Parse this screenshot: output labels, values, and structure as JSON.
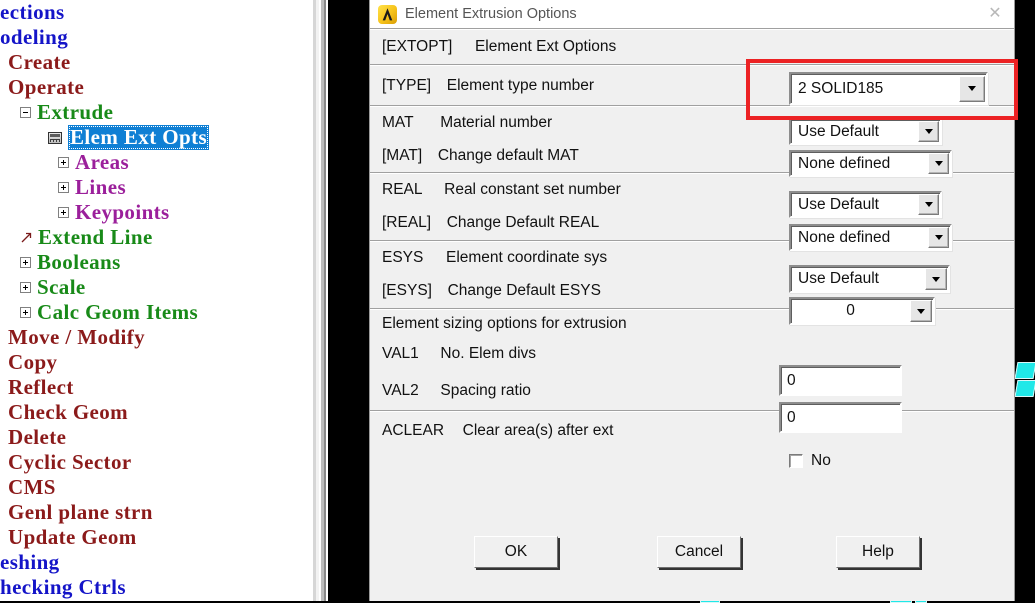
{
  "window": {
    "title": "Element Extrusion Options",
    "logo_icon": "ansys-logo-icon",
    "close_icon": "close-icon",
    "close_glyph": "✕"
  },
  "tree": {
    "items": [
      {
        "label": "ections",
        "color": "#1414c8",
        "indent": 0,
        "icon": "none"
      },
      {
        "label": "odeling",
        "color": "#1414c8",
        "indent": 0,
        "icon": "none"
      },
      {
        "label": "Create",
        "color": "#8b1a1a",
        "indent": 8,
        "icon": "none"
      },
      {
        "label": "Operate",
        "color": "#8b1a1a",
        "indent": 8,
        "icon": "none"
      },
      {
        "label": "Extrude",
        "color": "#188a18",
        "indent": 20,
        "icon": "minus"
      },
      {
        "label": "Elem Ext Opts",
        "color": "#1414c8",
        "indent": 48,
        "icon": "sheet",
        "selected": true
      },
      {
        "label": "Areas",
        "color": "#9b1f9b",
        "indent": 58,
        "icon": "plus"
      },
      {
        "label": "Lines",
        "color": "#9b1f9b",
        "indent": 58,
        "icon": "plus"
      },
      {
        "label": "Keypoints",
        "color": "#9b1f9b",
        "indent": 58,
        "icon": "plus"
      },
      {
        "label": "Extend Line",
        "color": "#188a18",
        "indent": 20,
        "icon": "arrow"
      },
      {
        "label": "Booleans",
        "color": "#188a18",
        "indent": 20,
        "icon": "plus"
      },
      {
        "label": "Scale",
        "color": "#188a18",
        "indent": 20,
        "icon": "plus"
      },
      {
        "label": "Calc Geom Items",
        "color": "#188a18",
        "indent": 20,
        "icon": "plus"
      },
      {
        "label": "Move / Modify",
        "color": "#8b1a1a",
        "indent": 8,
        "icon": "none"
      },
      {
        "label": "Copy",
        "color": "#8b1a1a",
        "indent": 8,
        "icon": "none"
      },
      {
        "label": "Reflect",
        "color": "#8b1a1a",
        "indent": 8,
        "icon": "none"
      },
      {
        "label": "Check Geom",
        "color": "#8b1a1a",
        "indent": 8,
        "icon": "none"
      },
      {
        "label": "Delete",
        "color": "#8b1a1a",
        "indent": 8,
        "icon": "none"
      },
      {
        "label": "Cyclic Sector",
        "color": "#8b1a1a",
        "indent": 8,
        "icon": "none"
      },
      {
        "label": "CMS",
        "color": "#8b1a1a",
        "indent": 8,
        "icon": "none"
      },
      {
        "label": "Genl plane strn",
        "color": "#8b1a1a",
        "indent": 8,
        "icon": "none"
      },
      {
        "label": "Update Geom",
        "color": "#8b1a1a",
        "indent": 8,
        "icon": "none"
      },
      {
        "label": "eshing",
        "color": "#1414c8",
        "indent": 0,
        "icon": "none"
      },
      {
        "label": "hecking Ctrls",
        "color": "#1414c8",
        "indent": 0,
        "icon": "none"
      }
    ]
  },
  "dialog": {
    "section_header": {
      "code": "[EXTOPT]",
      "desc": "Element Ext Options"
    },
    "rows": [
      {
        "code": "[TYPE]",
        "desc": "Element type number",
        "control": "combo",
        "value": "2    SOLID185",
        "align": "left",
        "highlighted": true
      },
      {
        "code": "MAT",
        "desc": "Material number",
        "control": "combo",
        "value": "Use Default",
        "align": "left"
      },
      {
        "code": "[MAT]",
        "desc": "Change default MAT",
        "control": "combo",
        "value": "None defined",
        "align": "left"
      },
      {
        "code": "REAL",
        "desc": "Real constant set number",
        "control": "combo",
        "value": "Use Default",
        "align": "left"
      },
      {
        "code": "[REAL]",
        "desc": "Change Default REAL",
        "control": "combo",
        "value": "None defined",
        "align": "left"
      },
      {
        "code": "ESYS",
        "desc": "Element coordinate sys",
        "control": "combo",
        "value": "Use Default",
        "align": "left"
      },
      {
        "code": "[ESYS]",
        "desc": "Change Default ESYS",
        "control": "combo",
        "value": "0",
        "align": "center"
      }
    ],
    "sizing_header": "Element sizing options for extrusion",
    "sizing_rows": [
      {
        "code": "VAL1",
        "desc": "No. Elem divs",
        "control": "text",
        "value": "0"
      },
      {
        "code": "VAL2",
        "desc": "Spacing ratio",
        "control": "text",
        "value": "0"
      }
    ],
    "aclear": {
      "code": "ACLEAR",
      "desc": "Clear area(s) after ext",
      "checked": false,
      "state_label": "No"
    },
    "buttons": [
      {
        "label": "OK"
      },
      {
        "label": "Cancel"
      },
      {
        "label": "Help"
      }
    ]
  },
  "annotation": {
    "highlight_color": "#ec2224",
    "target": "element-type-number-combobox"
  },
  "colors": {
    "selection_blue": "#0f7fd4",
    "dialog_face": "#f0f0f0",
    "mesh_cyan": "#20e8e8",
    "desktop": "#000000"
  }
}
